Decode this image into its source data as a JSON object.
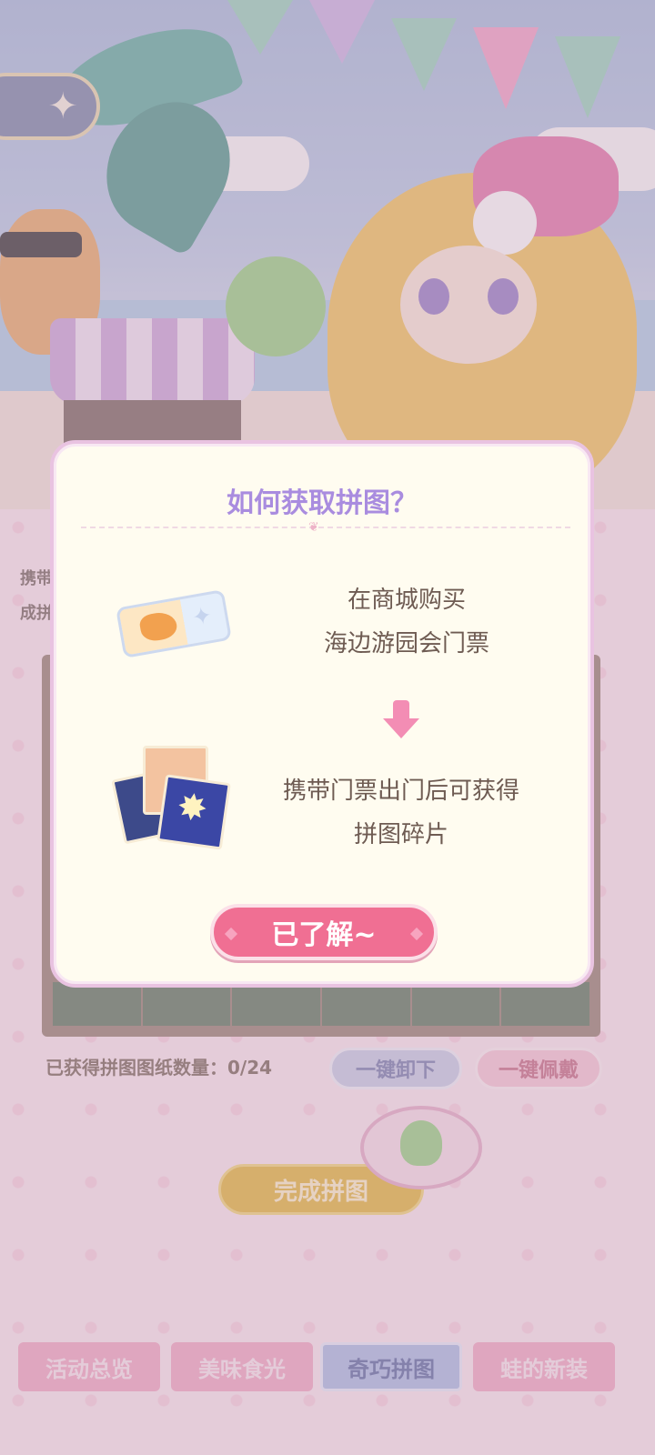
{
  "colors": {
    "accent_purple": "#a98cdf",
    "confirm_pink": "#f06f93",
    "finish_gold": "#e2b229",
    "tab_active_blue": "#a5b8e4"
  },
  "background": {
    "back_icon": "compass-star-icon",
    "left_info_line1": "携带",
    "left_info_line2": "成拼",
    "count_text": "已获得拼图图纸数量：0/24",
    "remove_all_label": "一键卸下",
    "wear_all_label": "一键佩戴",
    "finish_label": "完成拼图"
  },
  "tabs": [
    {
      "label": "活动总览",
      "active": false
    },
    {
      "label": "美味食光",
      "active": false
    },
    {
      "label": "奇巧拼图",
      "active": true
    },
    {
      "label": "蛙的新装",
      "active": false
    }
  ],
  "modal": {
    "title": "如何获取拼图？",
    "step1_line1": "在商城购买",
    "step1_line2": "海边游园会门票",
    "step1_icon": "ticket-icon",
    "arrow_icon": "arrow-down-icon",
    "step2_line1": "携带门票出门后可获得",
    "step2_line2": "拼图碎片",
    "step2_icon": "puzzle-cards-icon",
    "confirm_label": "已了解~"
  }
}
